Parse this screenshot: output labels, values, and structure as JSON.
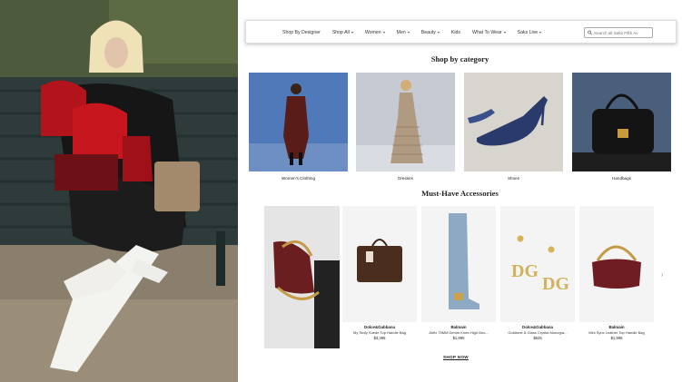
{
  "nav": {
    "items": [
      {
        "label": "Shop By Designer",
        "caret": false
      },
      {
        "label": "Shop All",
        "caret": true
      },
      {
        "label": "Women",
        "caret": true
      },
      {
        "label": "Men",
        "caret": true
      },
      {
        "label": "Beauty",
        "caret": true
      },
      {
        "label": "Kids",
        "caret": false
      },
      {
        "label": "What To Wear",
        "caret": true
      },
      {
        "label": "Saks Live",
        "caret": true
      }
    ],
    "search_placeholder": "Search all Saks Fifth Av"
  },
  "shop_by_category": {
    "title": "Shop by category",
    "categories": [
      {
        "label": "Women's Clothing"
      },
      {
        "label": "Dresses"
      },
      {
        "label": "Shoes"
      },
      {
        "label": "Handbags"
      }
    ]
  },
  "accessories": {
    "title": "Must-Have Accessories",
    "products": [
      {
        "brand": "Dolce&Gabbana",
        "name": "My Sicily Suede Top Handle Bag",
        "price": "$3,395"
      },
      {
        "brand": "Balmain",
        "name": "Airfix 75MM Denim Knee-High Boo...",
        "price": "$1,995"
      },
      {
        "brand": "Dolce&Gabbana",
        "name": "Goldtone & Glass Crystal Monogra...",
        "price": "$625"
      },
      {
        "brand": "Balmain",
        "name": "Mini Sync Leather Top Handle Bag",
        "price": "$1,995"
      }
    ],
    "shop_now_label": "SHOP NOW"
  },
  "icons": {
    "search": "search-icon",
    "next": "chevron-right-icon",
    "caret": "chevron-down-icon"
  }
}
